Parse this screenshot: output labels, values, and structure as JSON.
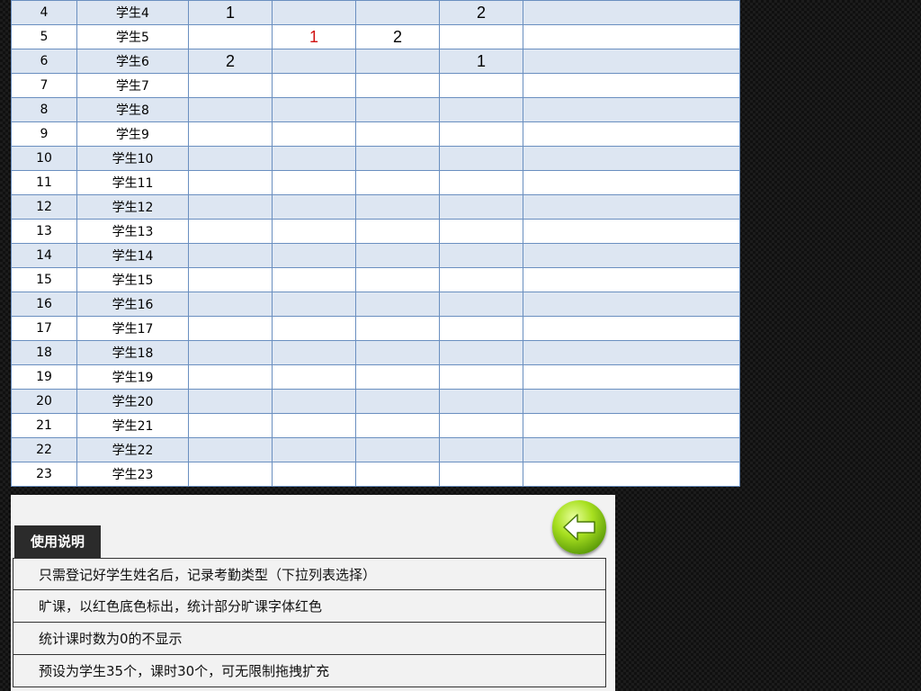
{
  "table": {
    "rows": [
      {
        "num": "4",
        "name": "学生4",
        "c1": "1",
        "c2": "",
        "c3": "",
        "c4": "2",
        "c5": ""
      },
      {
        "num": "5",
        "name": "学生5",
        "c1": "",
        "c2": "1",
        "c3": "2",
        "c4": "",
        "c5": ""
      },
      {
        "num": "6",
        "name": "学生6",
        "c1": "2",
        "c2": "",
        "c3": "",
        "c4": "1",
        "c5": ""
      },
      {
        "num": "7",
        "name": "学生7",
        "c1": "",
        "c2": "",
        "c3": "",
        "c4": "",
        "c5": ""
      },
      {
        "num": "8",
        "name": "学生8",
        "c1": "",
        "c2": "",
        "c3": "",
        "c4": "",
        "c5": ""
      },
      {
        "num": "9",
        "name": "学生9",
        "c1": "",
        "c2": "",
        "c3": "",
        "c4": "",
        "c5": ""
      },
      {
        "num": "10",
        "name": "学生10",
        "c1": "",
        "c2": "",
        "c3": "",
        "c4": "",
        "c5": ""
      },
      {
        "num": "11",
        "name": "学生11",
        "c1": "",
        "c2": "",
        "c3": "",
        "c4": "",
        "c5": ""
      },
      {
        "num": "12",
        "name": "学生12",
        "c1": "",
        "c2": "",
        "c3": "",
        "c4": "",
        "c5": ""
      },
      {
        "num": "13",
        "name": "学生13",
        "c1": "",
        "c2": "",
        "c3": "",
        "c4": "",
        "c5": ""
      },
      {
        "num": "14",
        "name": "学生14",
        "c1": "",
        "c2": "",
        "c3": "",
        "c4": "",
        "c5": ""
      },
      {
        "num": "15",
        "name": "学生15",
        "c1": "",
        "c2": "",
        "c3": "",
        "c4": "",
        "c5": ""
      },
      {
        "num": "16",
        "name": "学生16",
        "c1": "",
        "c2": "",
        "c3": "",
        "c4": "",
        "c5": ""
      },
      {
        "num": "17",
        "name": "学生17",
        "c1": "",
        "c2": "",
        "c3": "",
        "c4": "",
        "c5": ""
      },
      {
        "num": "18",
        "name": "学生18",
        "c1": "",
        "c2": "",
        "c3": "",
        "c4": "",
        "c5": ""
      },
      {
        "num": "19",
        "name": "学生19",
        "c1": "",
        "c2": "",
        "c3": "",
        "c4": "",
        "c5": ""
      },
      {
        "num": "20",
        "name": "学生20",
        "c1": "",
        "c2": "",
        "c3": "",
        "c4": "",
        "c5": ""
      },
      {
        "num": "21",
        "name": "学生21",
        "c1": "",
        "c2": "",
        "c3": "",
        "c4": "",
        "c5": ""
      },
      {
        "num": "22",
        "name": "学生22",
        "c1": "",
        "c2": "",
        "c3": "",
        "c4": "",
        "c5": ""
      },
      {
        "num": "23",
        "name": "学生23",
        "c1": "",
        "c2": "",
        "c3": "",
        "c4": "",
        "c5": ""
      }
    ]
  },
  "instructions": {
    "title": "使用说明",
    "items": [
      "只需登记好学生姓名后，记录考勤类型（下拉列表选择）",
      "旷课，以红色底色标出，统计部分旷课字体红色",
      "统计课时数为0的不显示",
      "预设为学生35个，课时30个，可无限制拖拽扩充"
    ],
    "back_icon": "back-arrow-icon"
  },
  "colors": {
    "band": "#dde6f2",
    "grid": "#6a8fc0",
    "absent_text": "#d01010",
    "back_button": "#8cc81a"
  }
}
